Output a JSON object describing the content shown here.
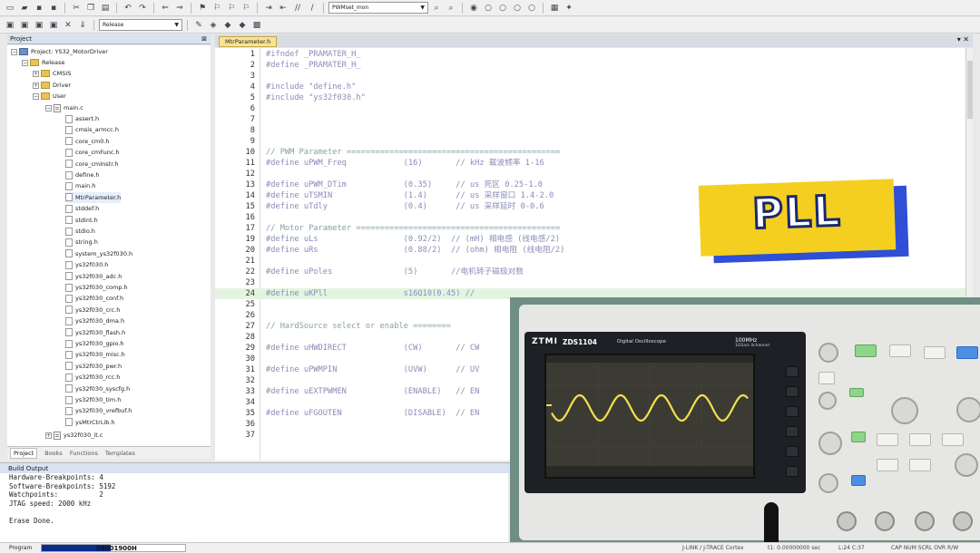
{
  "toolbar": {
    "target_combo": "PWMset_mon",
    "release_combo": "Release"
  },
  "project": {
    "panel_title": "Project",
    "root": "Project: YS32_MotorDriver",
    "target": "Release",
    "groups": [
      "CMSIS",
      "Driver",
      "User"
    ],
    "main_file": "main.c",
    "headers": [
      "assert.h",
      "cmsis_armcc.h",
      "core_cm0.h",
      "core_cmFunc.h",
      "core_cmInstr.h",
      "define.h",
      "main.h",
      "MtrParameter.h",
      "stddef.h",
      "stdint.h",
      "stdio.h",
      "string.h",
      "system_ys32f030.h",
      "ys32f030.h",
      "ys32f030_adc.h",
      "ys32f030_comp.h",
      "ys32f030_conf.h",
      "ys32f030_crc.h",
      "ys32f030_dma.h",
      "ys32f030_flash.h",
      "ys32f030_gpio.h",
      "ys32f030_misc.h",
      "ys32f030_pwr.h",
      "ys32f030_rcc.h",
      "ys32f030_syscfg.h",
      "ys32f030_tim.h",
      "ys32f030_vrefbuf.h",
      "ysMtrCtrLib.h"
    ],
    "last_file": "ys32f030_it.c",
    "tabs": [
      "Project",
      "Books",
      "Functions",
      "Templates"
    ]
  },
  "editor": {
    "tab_label": "MtrParameter.h",
    "lines": [
      {
        "n": "1",
        "t": "#ifndef _PRAMATER_H_"
      },
      {
        "n": "2",
        "t": "#define _PRAMATER_H_"
      },
      {
        "n": "3",
        "t": ""
      },
      {
        "n": "4",
        "t": "#include \"define.h\""
      },
      {
        "n": "5",
        "t": "#include \"ys32f030.h\""
      },
      {
        "n": "6",
        "t": ""
      },
      {
        "n": "7",
        "t": ""
      },
      {
        "n": "8",
        "t": ""
      },
      {
        "n": "9",
        "t": ""
      },
      {
        "n": "10",
        "t": "// PWM Parameter ============================================="
      },
      {
        "n": "11",
        "t": "#define uPWM_Freq            (16)       // kHz 载波频率 1-16"
      },
      {
        "n": "12",
        "t": ""
      },
      {
        "n": "13",
        "t": "#define uPWM_DTim            (0.35)     // us 死区 0.25-1.0"
      },
      {
        "n": "14",
        "t": "#define uTSMIN               (1.4)      // us 采样窗口 1.4-2.0"
      },
      {
        "n": "15",
        "t": "#define uTdly                (0.4)      // us 采样延时 0-0.6"
      },
      {
        "n": "16",
        "t": ""
      },
      {
        "n": "17",
        "t": "// Motor Parameter ==========================================="
      },
      {
        "n": "19",
        "t": "#define uLs                  (0.92/2)  // (mH) 相电感 (线电感/2)"
      },
      {
        "n": "20",
        "t": "#define uRs                  (0.88/2)  // (ohm) 相电阻 (线电阻/2)"
      },
      {
        "n": "21",
        "t": ""
      },
      {
        "n": "22",
        "t": "#define uPoles               (5)       //电机转子磁极对数"
      },
      {
        "n": "23",
        "t": ""
      },
      {
        "n": "24",
        "t": "#define uKPll                s16Q10(0.45) //"
      },
      {
        "n": "25",
        "t": ""
      },
      {
        "n": "26",
        "t": ""
      },
      {
        "n": "27",
        "t": "// HardSource select or enable ========"
      },
      {
        "n": "28",
        "t": ""
      },
      {
        "n": "29",
        "t": "#define uHWDIRECT            (CW)       // CW"
      },
      {
        "n": "30",
        "t": ""
      },
      {
        "n": "31",
        "t": "#define uPWMPIN              (UVW)      // UV"
      },
      {
        "n": "32",
        "t": ""
      },
      {
        "n": "33",
        "t": "#define uEXTPWMEN            (ENABLE)   // EN"
      },
      {
        "n": "34",
        "t": ""
      },
      {
        "n": "35",
        "t": "#define uFGOUTEN             (DISABLE)  // EN"
      },
      {
        "n": "36",
        "t": ""
      },
      {
        "n": "37",
        "t": ""
      }
    ]
  },
  "build": {
    "title": "Build Output",
    "lines": [
      "Hardware-Breakpoints: 4",
      "Software-Breakpoints: 5192",
      "Watchpoints:          2",
      "JTAG speed: 2000 kHz",
      "",
      "Erase Done."
    ]
  },
  "status": {
    "label": "Program",
    "address": "08001900H",
    "progress": 0.48,
    "debugger": "J-LINK / J-TRACE Cortex",
    "time": "t1: 0.00000000 sec",
    "cursor": "L:24 C:37",
    "flags": "CAP  NUM  SCRL  OVR  R/W"
  },
  "overlay": {
    "label": "PLL"
  },
  "scope": {
    "brand": "ZTMI",
    "model": "ZDS1104",
    "desc": "Digital Oscilloscope",
    "bandwidth": "100MHz",
    "rate": "1GSa/s 4channel"
  }
}
